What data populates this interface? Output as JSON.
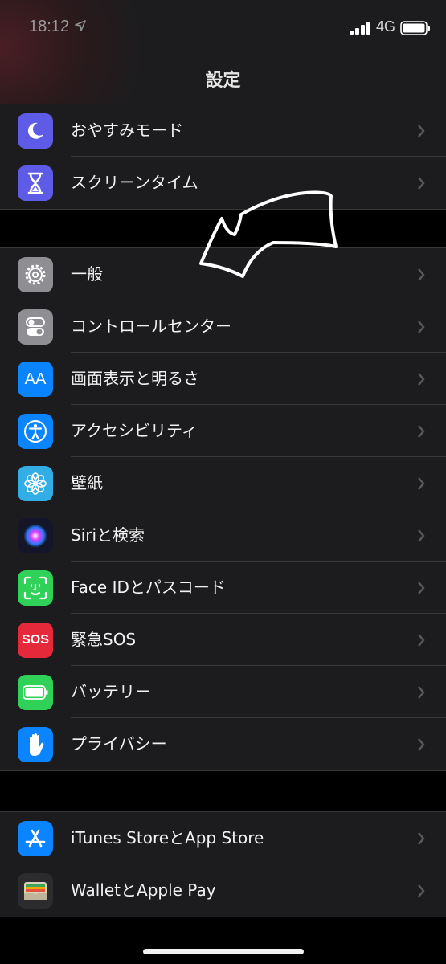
{
  "status_bar": {
    "time": "18:12",
    "network": "4G"
  },
  "nav": {
    "title": "設定"
  },
  "groups": [
    {
      "items": [
        {
          "label": "おやすみモード",
          "icon": "moon-icon",
          "color": "#5e5ce6"
        },
        {
          "label": "スクリーンタイム",
          "icon": "hourglass-icon",
          "color": "#5e5ce6"
        }
      ]
    },
    {
      "items": [
        {
          "label": "一般",
          "icon": "gear-icon",
          "color": "#8e8e93"
        },
        {
          "label": "コントロールセンター",
          "icon": "toggles-icon",
          "color": "#8e8e93"
        },
        {
          "label": "画面表示と明るさ",
          "icon": "text-size-icon",
          "color": "#0a84ff",
          "icon_text": "AA"
        },
        {
          "label": "アクセシビリティ",
          "icon": "accessibility-icon",
          "color": "#0a84ff"
        },
        {
          "label": "壁紙",
          "icon": "flower-icon",
          "color": "#32ade6"
        },
        {
          "label": "Siriと検索",
          "icon": "siri-icon",
          "color": "#1a1a2e"
        },
        {
          "label": "Face IDとパスコード",
          "icon": "face-id-icon",
          "color": "#30d158"
        },
        {
          "label": "緊急SOS",
          "icon": "sos-icon",
          "color": "#e5283a",
          "icon_text": "SOS"
        },
        {
          "label": "バッテリー",
          "icon": "battery-icon",
          "color": "#30d158"
        },
        {
          "label": "プライバシー",
          "icon": "hand-icon",
          "color": "#0a84ff"
        }
      ]
    },
    {
      "items": [
        {
          "label": "iTunes StoreとApp Store",
          "icon": "app-store-icon",
          "color": "#0a84ff"
        },
        {
          "label": "WalletとApple Pay",
          "icon": "wallet-icon",
          "color": "#2c2c2e"
        }
      ]
    }
  ]
}
